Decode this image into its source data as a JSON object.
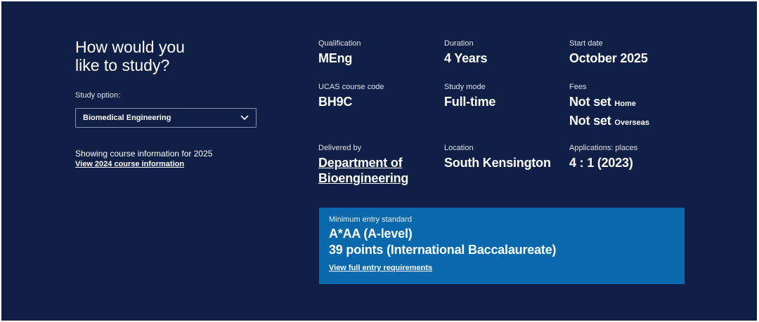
{
  "study": {
    "heading_line1": "How would you",
    "heading_line2": "like to study?",
    "option_label": "Study option:",
    "selected_option": "Biomedical Engineering",
    "showing_text": "Showing course information for 2025",
    "other_year_link": "View 2024 course information"
  },
  "details": {
    "qualification": {
      "label": "Qualification",
      "value": "MEng"
    },
    "duration": {
      "label": "Duration",
      "value": "4 Years"
    },
    "start_date": {
      "label": "Start date",
      "value": "October 2025"
    },
    "ucas_code": {
      "label": "UCAS course code",
      "value": "BH9C"
    },
    "study_mode": {
      "label": "Study mode",
      "value": "Full-time"
    },
    "fees": {
      "label": "Fees",
      "home_value": "Not set",
      "home_suffix": "Home",
      "overseas_value": "Not set",
      "overseas_suffix": "Overseas"
    },
    "delivered_by": {
      "label": "Delivered by",
      "line1": "Department of",
      "line2": "Bioengineering"
    },
    "location": {
      "label": "Location",
      "value": "South Kensington"
    },
    "applications": {
      "label": "Applications: places",
      "value": "4 : 1 (2023)"
    }
  },
  "entry": {
    "label": "Minimum entry standard",
    "line1": "A*AA (A-level)",
    "line2": "39 points (International Baccalaureate)",
    "link": "View full entry requirements"
  },
  "colors": {
    "background": "#0f1f46",
    "entry_box": "#0a69ad",
    "text": "#ffffff"
  },
  "icons": {
    "dropdown": "chevron-down-icon"
  }
}
